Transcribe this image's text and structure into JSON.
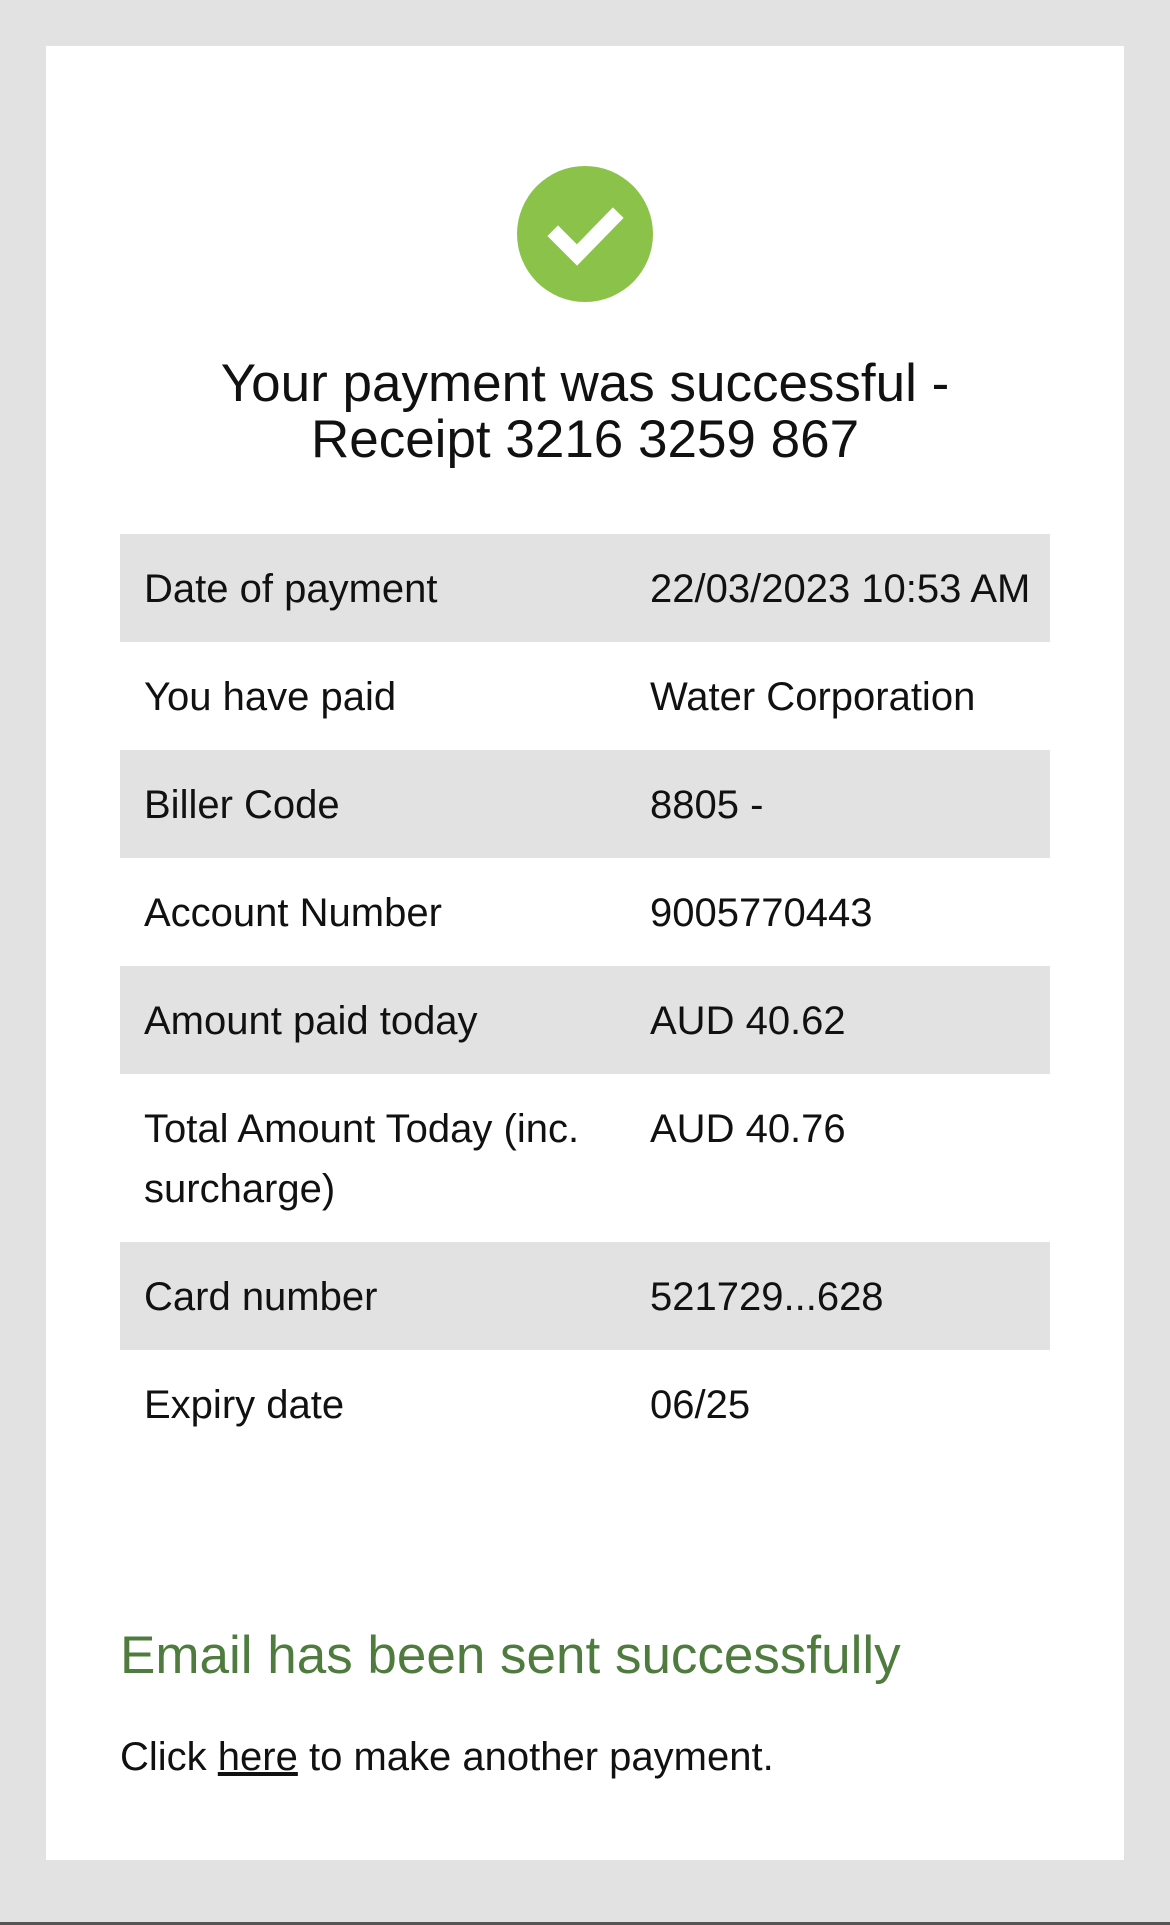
{
  "theme": {
    "success_color": "#8bc34a",
    "message_color": "#4f7c3e",
    "row_shade": "#e2e2e2"
  },
  "status_icon": "checkmark-circle-icon",
  "heading": {
    "line1": "Your payment was successful -",
    "line2": "Receipt 3216 3259 867"
  },
  "details": [
    {
      "label": "Date of payment",
      "value": "22/03/2023 10:53 AM"
    },
    {
      "label": "You have paid",
      "value": "Water Corporation"
    },
    {
      "label": "Biller Code",
      "value": "8805 -"
    },
    {
      "label": "Account Number",
      "value": "9005770443"
    },
    {
      "label": "Amount paid today",
      "value": "AUD 40.62"
    },
    {
      "label": "Total Amount Today (inc. surcharge)",
      "value": "AUD 40.76"
    },
    {
      "label": "Card number",
      "value": "521729...628"
    },
    {
      "label": "Expiry date",
      "value": "06/25"
    }
  ],
  "email_message": "Email has been sent successfully",
  "footer": {
    "prefix": "Click",
    "link_text": "here",
    "suffix": "to make another payment."
  }
}
